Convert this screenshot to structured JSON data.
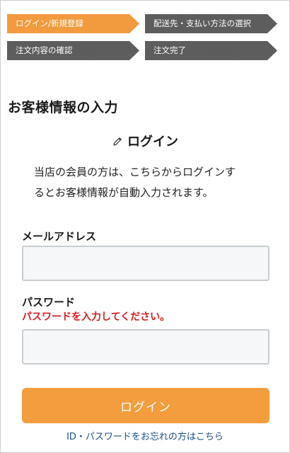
{
  "steps": [
    {
      "label": "ログイン/新規登録",
      "active": true
    },
    {
      "label": "配送先・支払い方法の選択",
      "active": false
    },
    {
      "label": "注文内容の確認",
      "active": false
    },
    {
      "label": "注文完了",
      "active": false
    }
  ],
  "page_title": "お客様情報の入力",
  "login_section": {
    "icon": "pencil-icon",
    "heading": "ログイン",
    "intro_line1": "当店の会員の方は、こちらからログインす",
    "intro_line2": "るとお客様情報が自動入力されます。"
  },
  "form": {
    "email_label": "メールアドレス",
    "email_value": "",
    "password_label": "パスワード",
    "password_error": "パスワードを入力してください。",
    "password_value": "",
    "submit_label": "ログイン",
    "forgot_link": "ID・パスワードをお忘れの方はこちら"
  },
  "colors": {
    "accent": "#f49d3f",
    "step_inactive": "#5a5a5a",
    "error": "#d21f1f",
    "link": "#1c4f8c"
  }
}
